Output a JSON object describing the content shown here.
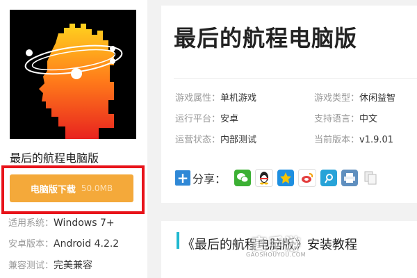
{
  "app": {
    "name": "最后的航程电脑版",
    "download_label": "电脑版下载",
    "download_size": "50.0MB"
  },
  "specs": [
    {
      "key": "适用系统：",
      "value": "Windows 7+"
    },
    {
      "key": "安卓版本：",
      "value": "Android 4.2.2"
    },
    {
      "key": "兼容测试：",
      "value": "完美兼容"
    }
  ],
  "game": {
    "title": "最后的航程电脑版",
    "info": [
      {
        "key": "游戏属性：",
        "value": "单机游戏"
      },
      {
        "key": "游戏类型：",
        "value": "休闲益智"
      },
      {
        "key": "运行平台：",
        "value": "安卓"
      },
      {
        "key": "支持语言：",
        "value": "中文"
      },
      {
        "key": "运营状态：",
        "value": "内部测试"
      },
      {
        "key": "当前版本：",
        "value": "v1.9.01"
      }
    ]
  },
  "share": {
    "plus": "+",
    "label": "分享：",
    "icons": [
      {
        "name": "wechat-icon",
        "color": "#3cb034"
      },
      {
        "name": "qq-icon",
        "color": "#1e8fe0"
      },
      {
        "name": "qzone-icon",
        "color": "#f5b800"
      },
      {
        "name": "weibo-icon",
        "color": "#e33e3e"
      },
      {
        "name": "tencent-weibo-icon",
        "color": "#27a3d8"
      },
      {
        "name": "print-icon",
        "color": "#5f8fbf"
      },
      {
        "name": "copy-icon",
        "color": "#cfcfcf"
      }
    ]
  },
  "tutorial": {
    "title": "《最后的航程电脑版》安装教程"
  },
  "watermark": {
    "main": "高手游",
    "sub": "GAOSHOUYOU.COM"
  }
}
